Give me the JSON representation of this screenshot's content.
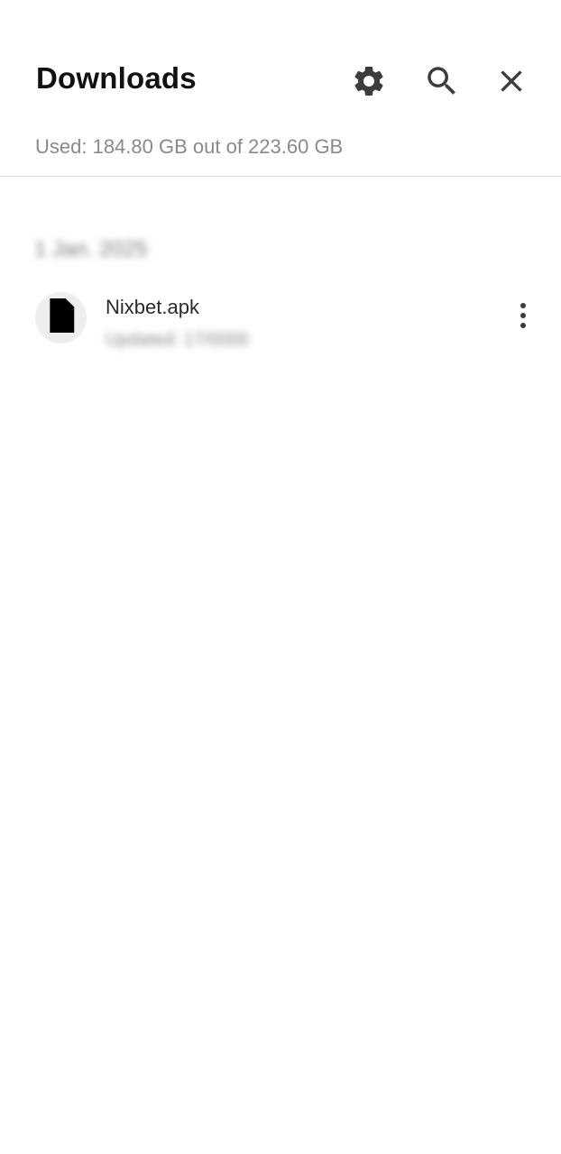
{
  "header": {
    "title": "Downloads",
    "settings_icon": "gear-icon",
    "search_icon": "search-icon",
    "close_icon": "close-icon"
  },
  "storage": {
    "text": "Used: 184.80 GB out of 223.60 GB"
  },
  "sections": [
    {
      "date": "1 Jan. 2025",
      "files": [
        {
          "name": "Nixbet.apk",
          "meta": "Updated: 17/0000",
          "icon": "file-icon",
          "menu_icon": "more-vert-icon"
        }
      ]
    }
  ],
  "colors": {
    "title": "#111111",
    "secondary_text": "#8a8a8a",
    "icon": "#3c3c3c",
    "icon_circle_bg": "#eeeeee",
    "divider": "#dcdcdc"
  }
}
